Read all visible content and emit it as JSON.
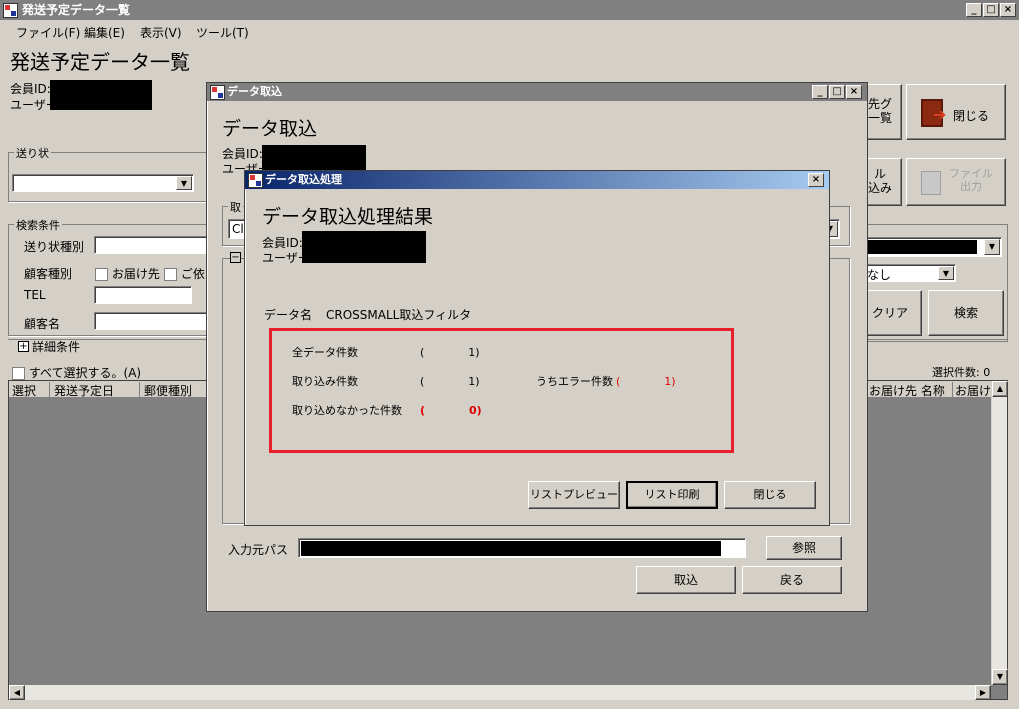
{
  "main": {
    "window_title": "発送予定データ一覧",
    "menu": [
      "ファイル(F)",
      "編集(E)",
      "表示(V)",
      "ツール(T)"
    ],
    "page_title": "発送予定データ一覧",
    "member_id_label": "会員ID:",
    "user_label": "ユーザー:",
    "okurijo_group": "送り状",
    "search_group": "検索条件",
    "search_rows": {
      "slip_type": "送り状種別",
      "customer_type": "顧客種別",
      "tel": "TEL",
      "customer_name": "顧客名"
    },
    "checkbox_todokesaki": "お届け先",
    "checkbox_irai": "ご依",
    "detail_condition": "詳細条件",
    "select_all": "すべて選択する。(A)",
    "selected_count": "選択件数: 0",
    "grid_columns": [
      "選択",
      "発送予定日",
      "郵便種別"
    ],
    "grid_columns_right": [
      "お届け先 名称",
      "お届け"
    ],
    "btn_shukka_list": "先グ\n一覧",
    "btn_close": "閉じる",
    "btn_file_import": "ル\n込み",
    "btn_file_output": "ファイル\n出力",
    "combo_nashi": "なし",
    "btn_clear": "クリア",
    "btn_search": "検索"
  },
  "import_dialog": {
    "title": "データ取込",
    "heading": "データ取込",
    "member_id_label": "会員ID:",
    "user_label": "ユーザー:",
    "group_fragment": "取",
    "combo_fragment": "Cl",
    "input_path_label": "入力元パス",
    "btn_browse": "参照",
    "btn_import": "取込",
    "btn_back": "戻る"
  },
  "result_dialog": {
    "title": "データ取込処理",
    "heading": "データ取込処理結果",
    "member_id_label": "会員ID:",
    "user_label": "ユーザー:",
    "data_name_label": "データ名",
    "data_name_value": "CROSSMALL取込フィルタ",
    "rows": {
      "total_label": "全データ件数",
      "total_value": "(　　　　1)",
      "imported_label": "取り込み件数",
      "imported_value": "(　　　　1)",
      "error_label": "うちエラー件数",
      "error_value": "(　　　　1)",
      "not_imported_label": "取り込めなかった件数",
      "not_imported_value": "(　　　　0)"
    },
    "btn_preview": "リストプレビュー",
    "btn_print": "リスト印刷",
    "btn_close": "閉じる"
  },
  "colors": {
    "highlight_box": "#e8202a",
    "error_text": "#e00000"
  }
}
